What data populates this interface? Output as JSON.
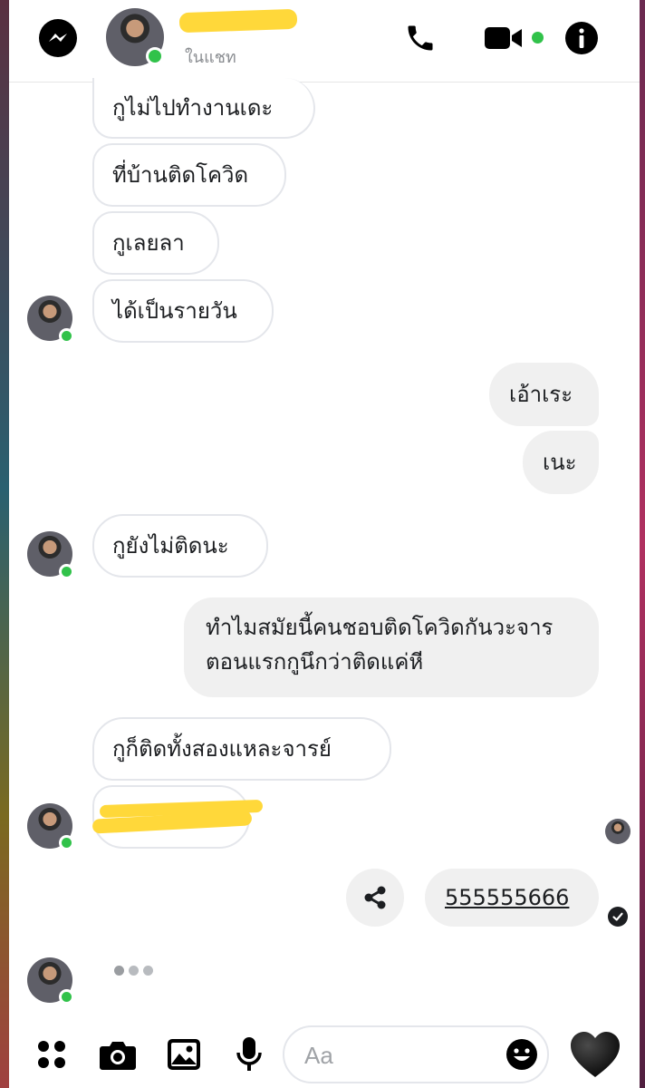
{
  "header": {
    "status": "ในแชท",
    "icons": [
      "messenger-icon",
      "phone-icon",
      "video-camera-icon",
      "info-icon"
    ]
  },
  "messages": {
    "m1": "กูไม่ไปทำงานเดะ",
    "m2": "ที่บ้านติดโควิด",
    "m3": "กูเลยลา",
    "m4": "ได้เป็นรายวัน",
    "m5": "เอ้าเระ",
    "m6": "เนะ",
    "m7": "กูยังไม่ติดนะ",
    "m8": "ทำไมสมัยนี้คนชอบติดโควิดกันวะจาร ตอนแรกกูนึกว่าติดแค่หี",
    "m9": "กูก็ติดทั้งสองแหละจารย์",
    "m11": "555555666"
  },
  "composer": {
    "placeholder": "Aa",
    "icons": [
      "apps-icon",
      "camera-icon",
      "image-icon",
      "microphone-icon",
      "emoji-icon",
      "heart-icon"
    ]
  },
  "colors": {
    "online": "#31c24a",
    "incoming_border": "#e4e6eb",
    "outgoing_bg": "#f0f0f0",
    "redaction": "#ffd83a"
  }
}
